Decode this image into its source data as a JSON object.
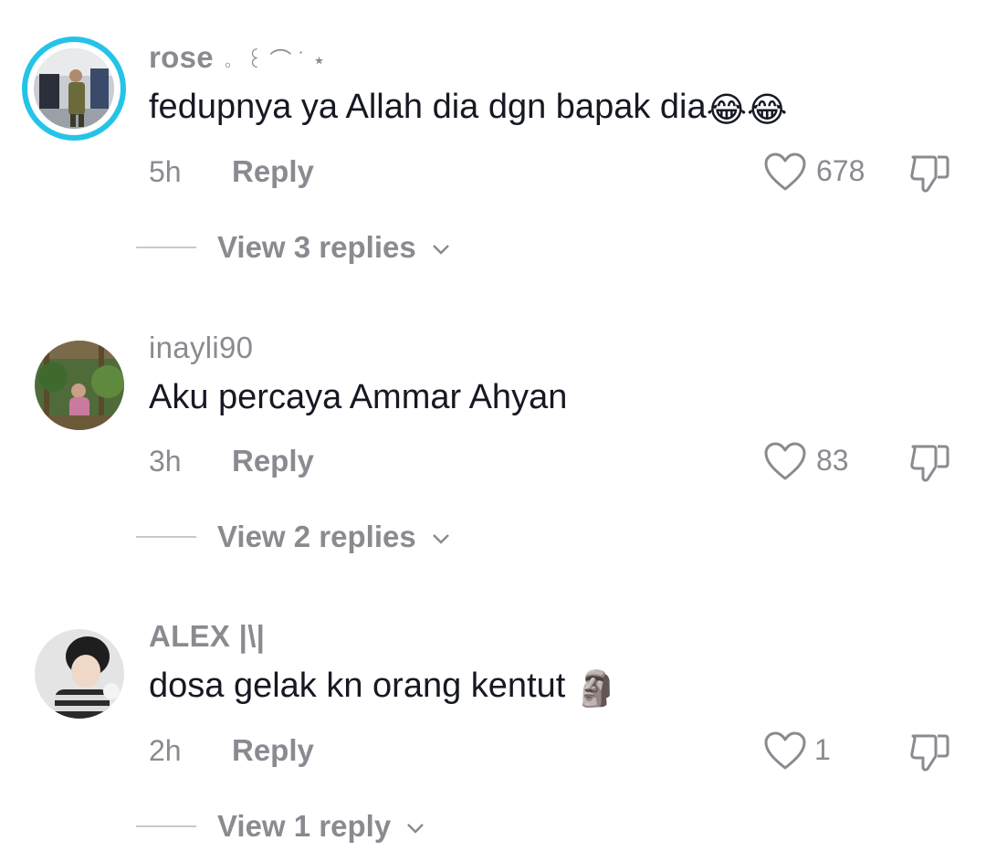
{
  "comments": [
    {
      "username": "rose",
      "username_deco": "。   ꒰ ⌒ ˙ ⋆",
      "text": "fedupnya ya Allah dia dgn bapak dia",
      "emoji": "😂😂",
      "time": "5h",
      "reply_label": "Reply",
      "likes": "678",
      "view_replies": "View 3 replies",
      "avatar_ring_color": "#25c3e8"
    },
    {
      "username": "inayli90",
      "text": "Aku percaya Ammar Ahyan",
      "time": "3h",
      "reply_label": "Reply",
      "likes": "83",
      "view_replies": "View 2 replies"
    },
    {
      "username": "ALEX |\\|",
      "text": "dosa gelak kn orang kentut",
      "emoji": "🗿",
      "time": "2h",
      "reply_label": "Reply",
      "likes": "1",
      "view_replies": "View 1 reply"
    }
  ],
  "colors": {
    "primary_text": "#161823",
    "secondary_text": "#8a8b91",
    "ring": "#25c3e8"
  },
  "icons": {
    "like": "heart-outline-icon",
    "dislike": "thumbs-down-outline-icon",
    "expand": "chevron-down-icon"
  }
}
